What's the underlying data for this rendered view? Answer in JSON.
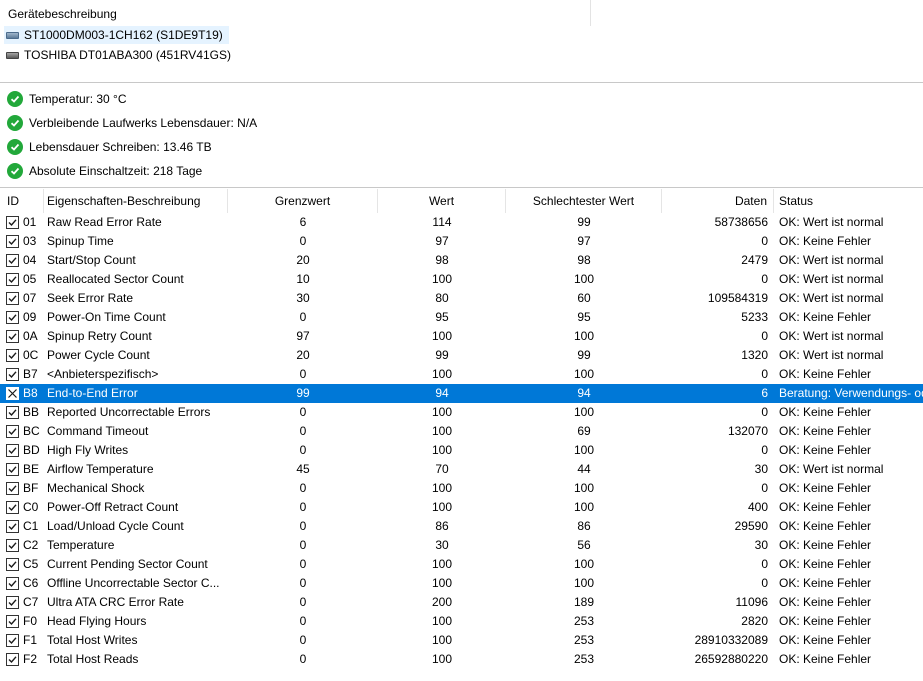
{
  "devices_panel": {
    "title": "Gerätebeschreibung",
    "devices": [
      {
        "label": "ST1000DM003-1CH162 (S1DE9T19)",
        "selected": true
      },
      {
        "label": "TOSHIBA DT01ABA300 (451RV41GS)",
        "selected": false
      }
    ]
  },
  "status_panel": {
    "items": [
      {
        "text": "Temperatur: 30 °C"
      },
      {
        "text": "Verbleibende Laufwerks Lebensdauer: N/A"
      },
      {
        "text": "Lebensdauer Schreiben: 13.46 TB"
      },
      {
        "text": "Absolute Einschaltzeit: 218 Tage"
      }
    ]
  },
  "smart_table": {
    "headers": {
      "id": "ID",
      "name": "Eigenschaften-Beschreibung",
      "threshold": "Grenzwert",
      "value": "Wert",
      "worst": "Schlechtester Wert",
      "data": "Daten",
      "status": "Status"
    },
    "rows": [
      {
        "id": "01",
        "name": "Raw Read Error Rate",
        "threshold": "6",
        "value": "114",
        "worst": "99",
        "data": "58738656",
        "status": "OK: Wert ist normal",
        "checked": true
      },
      {
        "id": "03",
        "name": "Spinup Time",
        "threshold": "0",
        "value": "97",
        "worst": "97",
        "data": "0",
        "status": "OK: Keine Fehler",
        "checked": true
      },
      {
        "id": "04",
        "name": "Start/Stop Count",
        "threshold": "20",
        "value": "98",
        "worst": "98",
        "data": "2479",
        "status": "OK: Wert ist normal",
        "checked": true
      },
      {
        "id": "05",
        "name": "Reallocated Sector Count",
        "threshold": "10",
        "value": "100",
        "worst": "100",
        "data": "0",
        "status": "OK: Wert ist normal",
        "checked": true
      },
      {
        "id": "07",
        "name": "Seek Error Rate",
        "threshold": "30",
        "value": "80",
        "worst": "60",
        "data": "109584319",
        "status": "OK: Wert ist normal",
        "checked": true
      },
      {
        "id": "09",
        "name": "Power-On Time Count",
        "threshold": "0",
        "value": "95",
        "worst": "95",
        "data": "5233",
        "status": "OK: Keine Fehler",
        "checked": true
      },
      {
        "id": "0A",
        "name": "Spinup Retry Count",
        "threshold": "97",
        "value": "100",
        "worst": "100",
        "data": "0",
        "status": "OK: Wert ist normal",
        "checked": true
      },
      {
        "id": "0C",
        "name": "Power Cycle Count",
        "threshold": "20",
        "value": "99",
        "worst": "99",
        "data": "1320",
        "status": "OK: Wert ist normal",
        "checked": true
      },
      {
        "id": "B7",
        "name": "<Anbieterspezifisch>",
        "threshold": "0",
        "value": "100",
        "worst": "100",
        "data": "0",
        "status": "OK: Keine Fehler",
        "checked": true
      },
      {
        "id": "B8",
        "name": "End-to-End Error",
        "threshold": "99",
        "value": "94",
        "worst": "94",
        "data": "6",
        "status": "Beratung: Verwendungs- od",
        "checked": false,
        "selected": true
      },
      {
        "id": "BB",
        "name": "Reported Uncorrectable Errors",
        "threshold": "0",
        "value": "100",
        "worst": "100",
        "data": "0",
        "status": "OK: Keine Fehler",
        "checked": true
      },
      {
        "id": "BC",
        "name": "Command Timeout",
        "threshold": "0",
        "value": "100",
        "worst": "69",
        "data": "132070",
        "status": "OK: Keine Fehler",
        "checked": true
      },
      {
        "id": "BD",
        "name": "High Fly Writes",
        "threshold": "0",
        "value": "100",
        "worst": "100",
        "data": "0",
        "status": "OK: Keine Fehler",
        "checked": true
      },
      {
        "id": "BE",
        "name": "Airflow Temperature",
        "threshold": "45",
        "value": "70",
        "worst": "44",
        "data": "30",
        "status": "OK: Wert ist normal",
        "checked": true
      },
      {
        "id": "BF",
        "name": "Mechanical Shock",
        "threshold": "0",
        "value": "100",
        "worst": "100",
        "data": "0",
        "status": "OK: Keine Fehler",
        "checked": true
      },
      {
        "id": "C0",
        "name": "Power-Off Retract Count",
        "threshold": "0",
        "value": "100",
        "worst": "100",
        "data": "400",
        "status": "OK: Keine Fehler",
        "checked": true
      },
      {
        "id": "C1",
        "name": "Load/Unload Cycle Count",
        "threshold": "0",
        "value": "86",
        "worst": "86",
        "data": "29590",
        "status": "OK: Keine Fehler",
        "checked": true
      },
      {
        "id": "C2",
        "name": "Temperature",
        "threshold": "0",
        "value": "30",
        "worst": "56",
        "data": "30",
        "status": "OK: Keine Fehler",
        "checked": true
      },
      {
        "id": "C5",
        "name": "Current Pending Sector Count",
        "threshold": "0",
        "value": "100",
        "worst": "100",
        "data": "0",
        "status": "OK: Keine Fehler",
        "checked": true
      },
      {
        "id": "C6",
        "name": "Offline Uncorrectable Sector C...",
        "threshold": "0",
        "value": "100",
        "worst": "100",
        "data": "0",
        "status": "OK: Keine Fehler",
        "checked": true
      },
      {
        "id": "C7",
        "name": "Ultra ATA CRC Error Rate",
        "threshold": "0",
        "value": "200",
        "worst": "189",
        "data": "11096",
        "status": "OK: Keine Fehler",
        "checked": true
      },
      {
        "id": "F0",
        "name": "Head Flying Hours",
        "threshold": "0",
        "value": "100",
        "worst": "253",
        "data": "2820",
        "status": "OK: Keine Fehler",
        "checked": true
      },
      {
        "id": "F1",
        "name": "Total Host Writes",
        "threshold": "0",
        "value": "100",
        "worst": "253",
        "data": "28910332089",
        "status": "OK: Keine Fehler",
        "checked": true
      },
      {
        "id": "F2",
        "name": "Total Host Reads",
        "threshold": "0",
        "value": "100",
        "worst": "253",
        "data": "26592880220",
        "status": "OK: Keine Fehler",
        "checked": true
      }
    ]
  },
  "colors": {
    "selection": "#0078d7",
    "ok_icon": "#22a83a"
  }
}
